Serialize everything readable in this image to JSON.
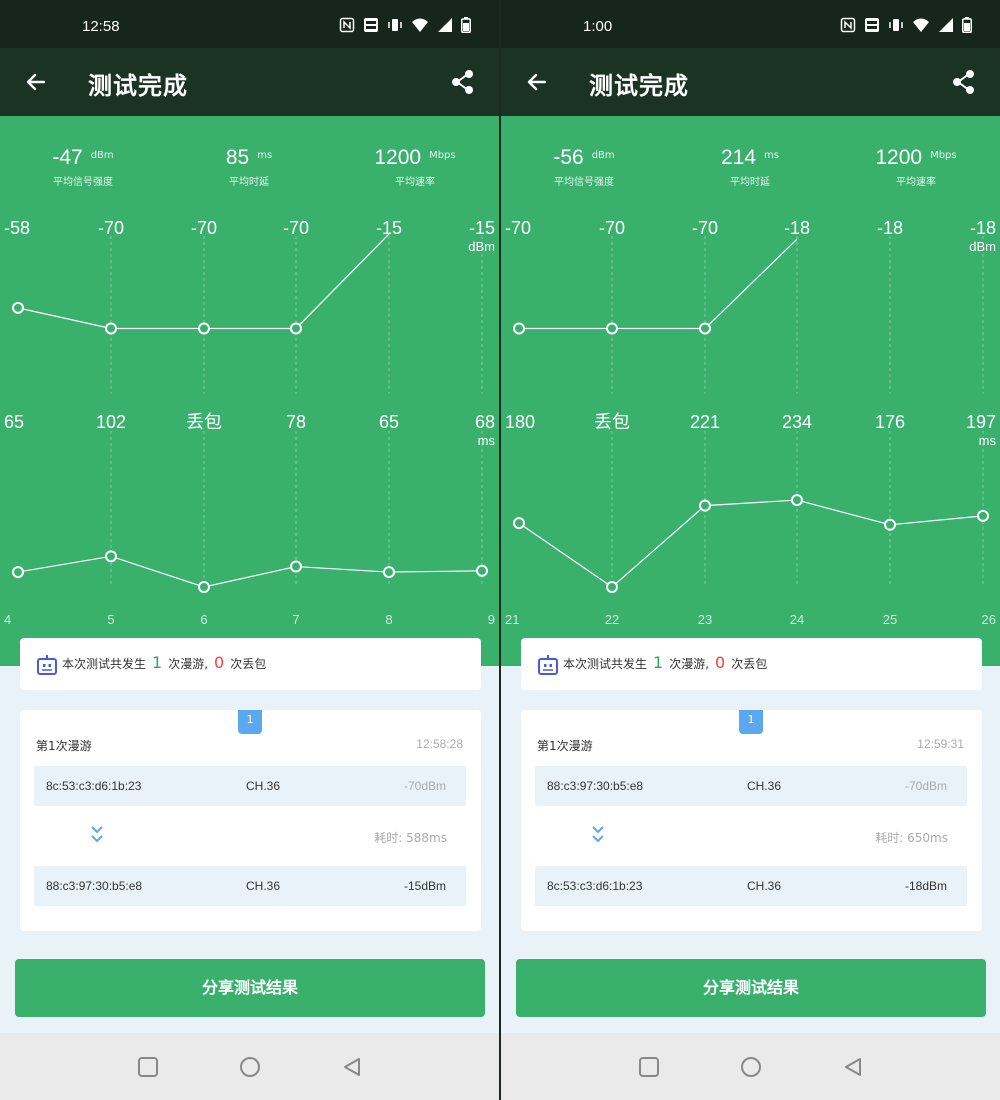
{
  "colors": {
    "green": "#39b16c",
    "header": "#1b3323",
    "status_bar": "#17261c",
    "loss_red": "#ff3b3b",
    "roam_green": "#2fa95d",
    "tag_blue": "#5aa8f0"
  },
  "screens": [
    {
      "time": "12:58",
      "title": "测试完成",
      "stats": [
        {
          "value": "-47",
          "unit": "dBm",
          "label": "平均信号强度"
        },
        {
          "value": "85",
          "unit": "ms",
          "label": "平均时延"
        },
        {
          "value": "1200",
          "unit": "Mbps",
          "label": "平均速率"
        }
      ],
      "summary": {
        "prefix": "本次测试共发生",
        "roam_count": "1",
        "mid": "次漫游,",
        "loss_count": "0",
        "suffix": "次丢包"
      },
      "roam": {
        "tag": "1",
        "title": "第1次漫游",
        "time": "12:58:28",
        "from": {
          "mac": "8c:53:c3:d6:1b:23",
          "ch": "CH.36",
          "signal": "-70dBm"
        },
        "duration": "耗时: 588ms",
        "to": {
          "mac": "88:c3:97:30:b5:e8",
          "ch": "CH.36",
          "signal": "-15dBm"
        }
      },
      "share_button": "分享测试结果"
    },
    {
      "time": "1:00",
      "title": "测试完成",
      "stats": [
        {
          "value": "-56",
          "unit": "dBm",
          "label": "平均信号强度"
        },
        {
          "value": "214",
          "unit": "ms",
          "label": "平均时延"
        },
        {
          "value": "1200",
          "unit": "Mbps",
          "label": "平均速率"
        }
      ],
      "summary": {
        "prefix": "本次测试共发生",
        "roam_count": "1",
        "mid": "次漫游,",
        "loss_count": "0",
        "suffix": "次丢包"
      },
      "roam": {
        "tag": "1",
        "title": "第1次漫游",
        "time": "12:59:31",
        "from": {
          "mac": "88:c3:97:30:b5:e8",
          "ch": "CH.36",
          "signal": "-70dBm"
        },
        "duration": "耗时: 650ms",
        "to": {
          "mac": "8c:53:c3:d6:1b:23",
          "ch": "CH.36",
          "signal": "-18dBm"
        }
      },
      "share_button": "分享测试结果"
    }
  ],
  "chart_data": [
    {
      "type": "line",
      "x": [
        "4",
        "5",
        "6",
        "7",
        "8",
        "9"
      ],
      "series": [
        {
          "values": [
            -58,
            -70,
            -70,
            -70,
            -15,
            -15
          ],
          "labels": [
            "-58",
            "-70",
            "-70",
            "-70",
            "-15",
            "-15"
          ],
          "unit": "dBm",
          "drawn_points": 5
        },
        {
          "values": [
            65,
            102,
            null,
            78,
            65,
            68
          ],
          "labels": [
            "65",
            "102",
            "丢包",
            "78",
            "65",
            "68"
          ],
          "unit": "ms"
        }
      ]
    },
    {
      "type": "line",
      "x": [
        "21",
        "22",
        "23",
        "24",
        "25",
        "26"
      ],
      "series": [
        {
          "values": [
            -70,
            -70,
            -70,
            -18,
            -18,
            -18
          ],
          "labels": [
            "-70",
            "-70",
            "-70",
            "-18",
            "-18",
            "-18"
          ],
          "unit": "dBm",
          "drawn_points": 4
        },
        {
          "values": [
            180,
            null,
            221,
            234,
            176,
            197
          ],
          "labels": [
            "180",
            "丢包",
            "221",
            "234",
            "176",
            "197"
          ],
          "unit": "ms"
        }
      ]
    }
  ]
}
